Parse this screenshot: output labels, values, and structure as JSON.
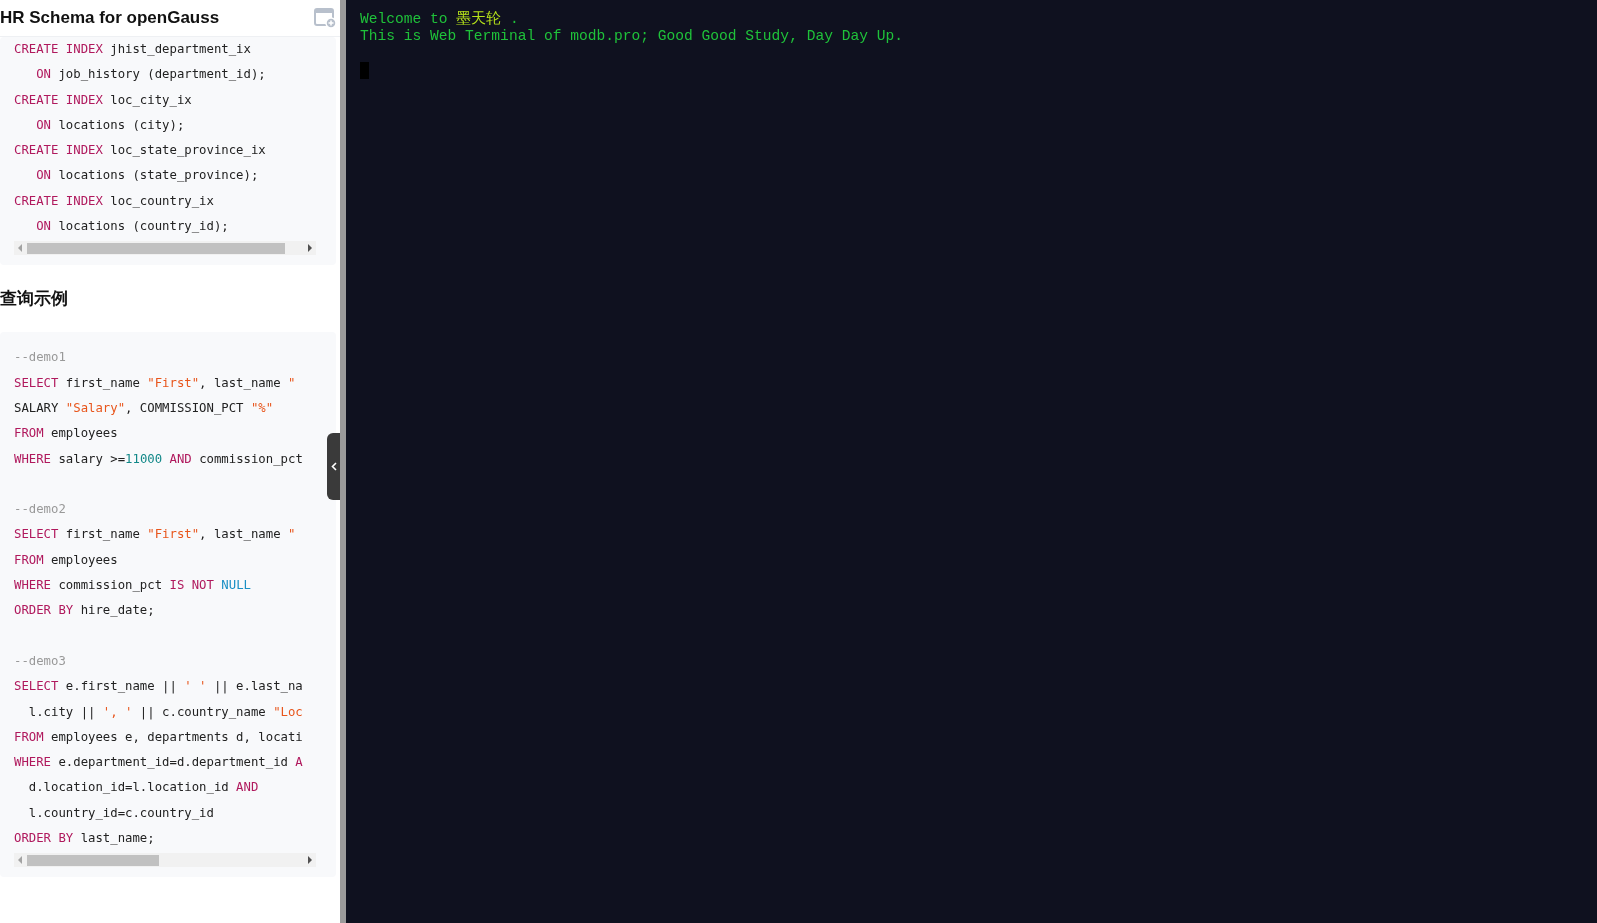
{
  "doc_panel": {
    "title": "HR Schema for openGauss",
    "code_blocks": [
      {
        "lines": [
          {
            "tokens": [
              {
                "kind": "kw",
                "text": "CREATE INDEX"
              },
              {
                "kind": "plain",
                "text": " jhist_department_ix"
              }
            ]
          },
          {
            "tokens": [
              {
                "kind": "kw",
                "text": "   ON"
              },
              {
                "kind": "plain",
                "text": " job_history (department_id);"
              }
            ]
          },
          {
            "tokens": [
              {
                "kind": "kw",
                "text": "CREATE INDEX"
              },
              {
                "kind": "plain",
                "text": " loc_city_ix"
              }
            ]
          },
          {
            "tokens": [
              {
                "kind": "kw",
                "text": "   ON"
              },
              {
                "kind": "plain",
                "text": " locations (city);"
              }
            ]
          },
          {
            "tokens": [
              {
                "kind": "kw",
                "text": "CREATE INDEX"
              },
              {
                "kind": "plain",
                "text": " loc_state_province_ix"
              }
            ]
          },
          {
            "tokens": [
              {
                "kind": "kw",
                "text": "   ON"
              },
              {
                "kind": "plain",
                "text": " locations (state_province);"
              }
            ]
          },
          {
            "tokens": [
              {
                "kind": "kw",
                "text": "CREATE INDEX"
              },
              {
                "kind": "plain",
                "text": " loc_country_ix"
              }
            ]
          },
          {
            "tokens": [
              {
                "kind": "kw",
                "text": "   ON"
              },
              {
                "kind": "plain",
                "text": " locations (country_id);"
              }
            ]
          }
        ]
      }
    ],
    "heading": "查询示例",
    "example_block": {
      "snippets": [
        {
          "lines": [
            {
              "tokens": [
                {
                  "kind": "comment",
                  "text": "--demo1"
                }
              ]
            },
            {
              "tokens": [
                {
                  "kind": "kw",
                  "text": "SELECT"
                },
                {
                  "kind": "plain",
                  "text": " first_name "
                },
                {
                  "kind": "str",
                  "text": "\"First\""
                },
                {
                  "kind": "plain",
                  "text": ", last_name "
                },
                {
                  "kind": "str",
                  "text": "\""
                }
              ]
            },
            {
              "tokens": [
                {
                  "kind": "plain",
                  "text": "SALARY "
                },
                {
                  "kind": "str",
                  "text": "\"Salary\""
                },
                {
                  "kind": "plain",
                  "text": ", COMMISSION_PCT "
                },
                {
                  "kind": "str",
                  "text": "\"%\""
                }
              ]
            },
            {
              "tokens": [
                {
                  "kind": "kw",
                  "text": "FROM"
                },
                {
                  "kind": "plain",
                  "text": " employees"
                }
              ]
            },
            {
              "tokens": [
                {
                  "kind": "kw",
                  "text": "WHERE"
                },
                {
                  "kind": "plain",
                  "text": " salary >="
                },
                {
                  "kind": "num",
                  "text": "11000"
                },
                {
                  "kind": "kw",
                  "text": " AND"
                },
                {
                  "kind": "plain",
                  "text": " commission_pct"
                }
              ]
            }
          ]
        },
        {
          "lines": [
            {
              "tokens": [
                {
                  "kind": "comment",
                  "text": "--demo2"
                }
              ]
            },
            {
              "tokens": [
                {
                  "kind": "kw",
                  "text": "SELECT"
                },
                {
                  "kind": "plain",
                  "text": " first_name "
                },
                {
                  "kind": "str",
                  "text": "\"First\""
                },
                {
                  "kind": "plain",
                  "text": ", last_name "
                },
                {
                  "kind": "str",
                  "text": "\""
                }
              ]
            },
            {
              "tokens": [
                {
                  "kind": "kw",
                  "text": "FROM"
                },
                {
                  "kind": "plain",
                  "text": " employees"
                }
              ]
            },
            {
              "tokens": [
                {
                  "kind": "kw",
                  "text": "WHERE"
                },
                {
                  "kind": "plain",
                  "text": " commission_pct "
                },
                {
                  "kind": "kw",
                  "text": "IS NOT"
                },
                {
                  "kind": "builtin",
                  "text": " NULL"
                }
              ]
            },
            {
              "tokens": [
                {
                  "kind": "kw",
                  "text": "ORDER BY"
                },
                {
                  "kind": "plain",
                  "text": " hire_date;"
                }
              ]
            }
          ]
        },
        {
          "lines": [
            {
              "tokens": [
                {
                  "kind": "comment",
                  "text": "--demo3"
                }
              ]
            },
            {
              "tokens": [
                {
                  "kind": "kw",
                  "text": "SELECT"
                },
                {
                  "kind": "plain",
                  "text": " e.first_name || "
                },
                {
                  "kind": "str",
                  "text": "' '"
                },
                {
                  "kind": "plain",
                  "text": " || e.last_na"
                }
              ]
            },
            {
              "tokens": [
                {
                  "kind": "plain",
                  "text": "  l.city || "
                },
                {
                  "kind": "str",
                  "text": "', '"
                },
                {
                  "kind": "plain",
                  "text": " || c.country_name "
                },
                {
                  "kind": "str",
                  "text": "\"Loc"
                }
              ]
            },
            {
              "tokens": [
                {
                  "kind": "kw",
                  "text": "FROM"
                },
                {
                  "kind": "plain",
                  "text": " employees e, departments d, locati"
                }
              ]
            },
            {
              "tokens": [
                {
                  "kind": "kw",
                  "text": "WHERE"
                },
                {
                  "kind": "plain",
                  "text": " e.department_id=d.department_id "
                },
                {
                  "kind": "kw",
                  "text": "A"
                }
              ]
            },
            {
              "tokens": [
                {
                  "kind": "plain",
                  "text": "  d.location_id=l.location_id "
                },
                {
                  "kind": "kw",
                  "text": "AND"
                }
              ]
            },
            {
              "tokens": [
                {
                  "kind": "plain",
                  "text": "  l.country_id=c.country_id"
                }
              ]
            },
            {
              "tokens": [
                {
                  "kind": "kw",
                  "text": "ORDER BY"
                },
                {
                  "kind": "plain",
                  "text": " last_name;"
                }
              ]
            }
          ]
        }
      ]
    }
  },
  "terminal": {
    "lines": [
      [
        {
          "kind": "plain",
          "text": "Welcome to "
        },
        {
          "kind": "accent",
          "text": "墨天轮"
        },
        {
          "kind": "plain",
          "text": " ."
        }
      ],
      [
        {
          "kind": "plain",
          "text": "This is Web Terminal of modb.pro; Good Good Study, Day Day Up."
        }
      ]
    ]
  }
}
